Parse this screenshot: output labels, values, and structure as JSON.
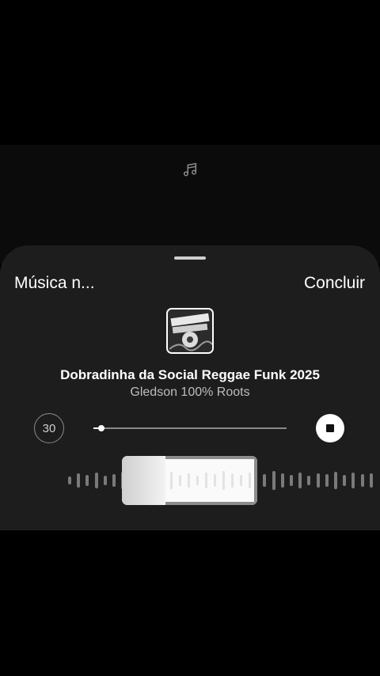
{
  "story": {
    "icon": "music-note-icon"
  },
  "sheet": {
    "header_left": "Música n...",
    "header_right": "Concluir"
  },
  "track": {
    "title": "Dobradinha da Social Reggae Funk 2025",
    "artist": "Gledson 100% Roots",
    "cover_icon": "album-cover"
  },
  "player": {
    "duration_label": "30",
    "progress": 0.04,
    "stop_icon": "stop-icon"
  },
  "waveform": {
    "bars": [
      10,
      18,
      14,
      20,
      12,
      16,
      22,
      14,
      18,
      12,
      20,
      16,
      24,
      18,
      14,
      20,
      16,
      22,
      12,
      18,
      14,
      20,
      16,
      24,
      18,
      14,
      20,
      12,
      18,
      16,
      22,
      14,
      20,
      16,
      18,
      12,
      20,
      14
    ]
  },
  "colors": {
    "sheet_bg": "#1d1d1d",
    "accent": "#ffffff"
  }
}
